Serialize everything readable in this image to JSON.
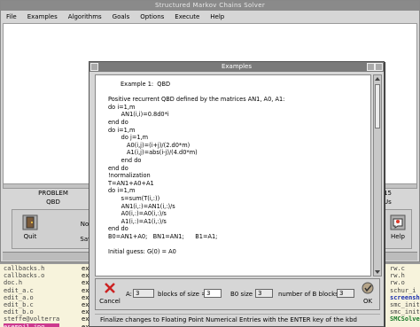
{
  "main_window": {
    "title": "Structured Markov Chains Solver",
    "menu": [
      "File",
      "Examples",
      "Algorithms",
      "Goals",
      "Options",
      "Execute",
      "Help"
    ],
    "problem_label": "PROBLEM",
    "problem_value": "QBD",
    "right_label_1": "15",
    "right_label_2": "Us",
    "toolbar": {
      "quit": "Quit",
      "save": "Save",
      "save_top": "Note",
      "help": "Help"
    }
  },
  "terminal": {
    "col1": [
      {
        "text": "callbacks.h",
        "style": "gray"
      },
      {
        "text": "callbacks.o",
        "style": "gray"
      },
      {
        "text": "doc.h",
        "style": "gray"
      },
      {
        "text": "edit_a.c",
        "style": "gray"
      },
      {
        "text": "edit_a.o",
        "style": "gray"
      },
      {
        "text": "edit_b.c",
        "style": "gray"
      },
      {
        "text": "edit_b.o",
        "style": "gray"
      },
      {
        "text": "steffe@volterra",
        "style": "gray"
      },
      {
        "text": "esempi1.jpg",
        "style": "hl"
      }
    ],
    "col2": [
      "ex",
      "ex",
      "ex",
      "ex",
      "ex",
      "ex",
      "ex",
      "ex",
      "ex"
    ],
    "col3": [
      {
        "text": "rw.c",
        "style": "gray"
      },
      {
        "text": "rw.h",
        "style": "gray"
      },
      {
        "text": "rw.o",
        "style": "gray"
      },
      {
        "text": "schur_i",
        "style": "gray"
      },
      {
        "text": "screensh",
        "style": "blue"
      },
      {
        "text": "smc_init",
        "style": "gray"
      },
      {
        "text": "smc_init",
        "style": "gray"
      },
      {
        "text": "SMCSolve",
        "style": "green"
      },
      {
        "text": "",
        "style": "gray"
      }
    ]
  },
  "dialog": {
    "title": "Examples",
    "lines": [
      "Example 1:  QBD",
      "",
      "Positive recurrent QBD defined by the matrices AN1, A0, A1:",
      "do i=1,m",
      "       AN1(i,i)=0.8d0*i",
      "end do",
      "do i=1,m",
      "       do j=1,m",
      "          A0(i,j)=(i+j)/(2.d0*m)",
      "          A1(i,j)=abs(i-j)/(4.d0*m)",
      "       end do",
      "end do",
      "!normalization",
      "T=AN1+A0+A1",
      "do i=1,m",
      "       s=sum(T(i,:))",
      "       AN1(i,:)=AN1(i,:)/s",
      "       A0(i,:)=A0(i,:)/s",
      "       A1(i,:)=A1(i,:)/s",
      "end do",
      "B0=AN1+A0;   BN1=AN1;      B1=A1;",
      "",
      "Initial guess: G(0) = A0"
    ],
    "panel": {
      "cancel": "Cancel",
      "a_label": "A:",
      "a_value": "3",
      "blocks_label": "blocks of size =",
      "blocks_value": "3",
      "b0_label": "B0 size =",
      "b0_value": "3",
      "numb_label": "number of B blocks =",
      "numb_value": "3",
      "ok": "OK"
    },
    "status": "Finalize changes to Floating Point Numerical Entries with the ENTER key of the kbd"
  }
}
